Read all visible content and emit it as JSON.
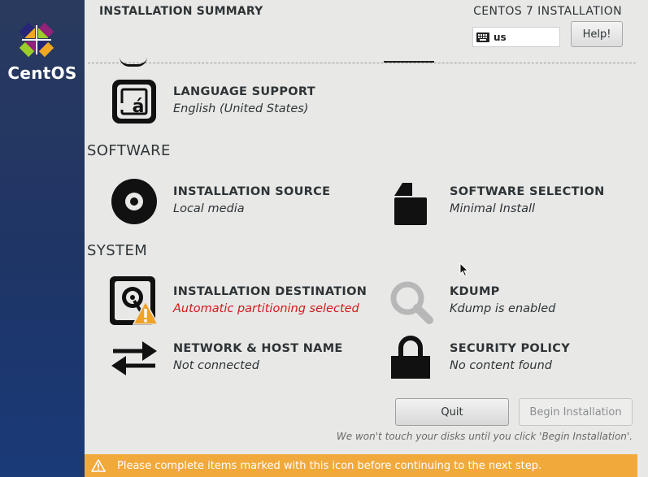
{
  "brand": {
    "name": "CentOS"
  },
  "header": {
    "title": "INSTALLATION SUMMARY",
    "product": "CENTOS 7 INSTALLATION",
    "keyboard_layout": "us",
    "help_label": "Help!"
  },
  "sections": {
    "software": "SOFTWARE",
    "system": "SYSTEM"
  },
  "spokes": {
    "language_support": {
      "title": "LANGUAGE SUPPORT",
      "status": "English (United States)",
      "icon": "language-icon"
    },
    "installation_source": {
      "title": "INSTALLATION SOURCE",
      "status": "Local media",
      "icon": "disc-icon"
    },
    "software_selection": {
      "title": "SOFTWARE SELECTION",
      "status": "Minimal Install",
      "icon": "package-icon"
    },
    "installation_destination": {
      "title": "INSTALLATION DESTINATION",
      "status": "Automatic partitioning selected",
      "icon": "harddisk-icon",
      "warning": true
    },
    "kdump": {
      "title": "KDUMP",
      "status": "Kdump is enabled",
      "icon": "magnifier-icon"
    },
    "network": {
      "title": "NETWORK & HOST NAME",
      "status": "Not connected",
      "icon": "network-arrows-icon"
    },
    "security_policy": {
      "title": "SECURITY POLICY",
      "status": "No content found",
      "icon": "lock-icon"
    }
  },
  "buttons": {
    "quit": "Quit",
    "begin": "Begin Installation"
  },
  "note": "We won't touch your disks until you click 'Begin Installation'.",
  "warning_bar": {
    "text": "Please complete items marked with this icon before continuing to the next step."
  },
  "colors": {
    "sidebar": "#1e3566",
    "warning_bar": "#f2a93b",
    "warning_text": "#d21a1a",
    "background": "#e8e8e7"
  }
}
